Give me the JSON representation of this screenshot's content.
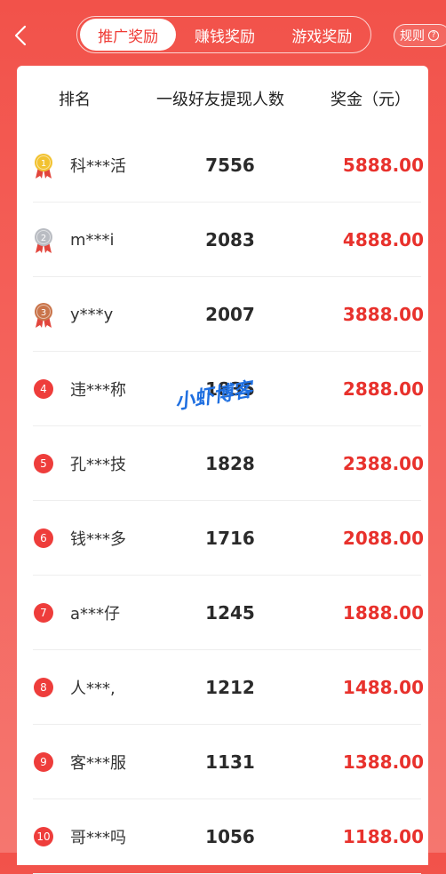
{
  "header": {
    "tabs": [
      {
        "label": "推广奖励",
        "active": true
      },
      {
        "label": "赚钱奖励",
        "active": false
      },
      {
        "label": "游戏奖励",
        "active": false
      }
    ],
    "rules_label": "规则",
    "rules_icon": "question-icon",
    "back_icon": "chevron-left-icon"
  },
  "table": {
    "columns": [
      "排名",
      "一级好友提现人数",
      "奖金（元）"
    ],
    "rows": [
      {
        "rank": "1",
        "name": "科***活",
        "count": "7556",
        "prize": "5888.00",
        "medal": "gold"
      },
      {
        "rank": "2",
        "name": "m***i",
        "count": "2083",
        "prize": "4888.00",
        "medal": "silver"
      },
      {
        "rank": "3",
        "name": "y***y",
        "count": "2007",
        "prize": "3888.00",
        "medal": "bronze"
      },
      {
        "rank": "4",
        "name": "违***称",
        "count": "1835",
        "prize": "2888.00"
      },
      {
        "rank": "5",
        "name": "孔***技",
        "count": "1828",
        "prize": "2388.00"
      },
      {
        "rank": "6",
        "name": "钱***多",
        "count": "1716",
        "prize": "2088.00"
      },
      {
        "rank": "7",
        "name": "a***仔",
        "count": "1245",
        "prize": "1888.00"
      },
      {
        "rank": "8",
        "name": "人***,",
        "count": "1212",
        "prize": "1488.00"
      },
      {
        "rank": "9",
        "name": "客***服",
        "count": "1131",
        "prize": "1388.00"
      },
      {
        "rank": "10",
        "name": "哥***吗",
        "count": "1056",
        "prize": "1188.00"
      }
    ]
  },
  "watermark": "小虾博客",
  "colors": {
    "accent": "#ee3d3b",
    "prize": "#e8312c",
    "gold": "#f2c230",
    "silver": "#b9bcc2",
    "bronze": "#c9744a"
  }
}
